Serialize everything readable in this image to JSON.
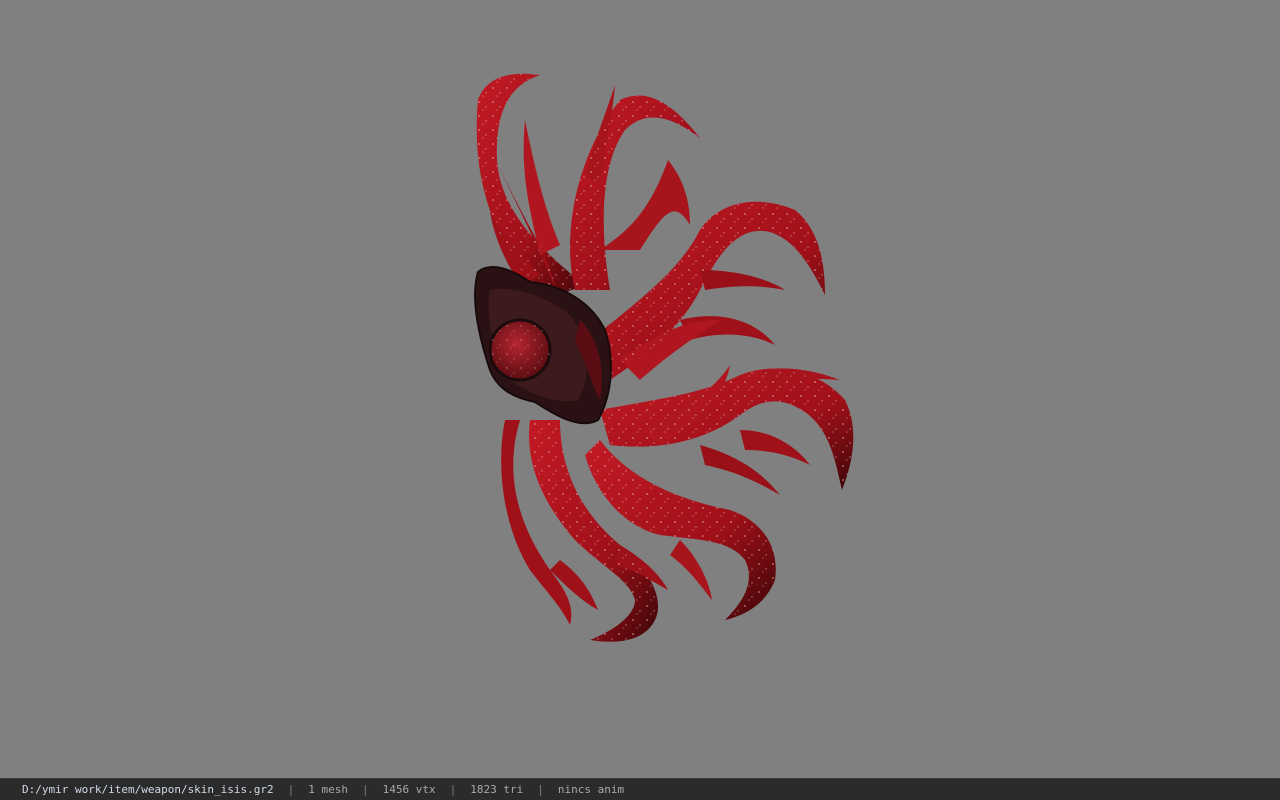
{
  "viewer": {
    "background_color": "#808080",
    "model_icon": "red-tentacle-shield-model",
    "model_colors": {
      "flesh": "#a8141c",
      "flesh_dark": "#4a0a0e",
      "core": "#2a1214",
      "eye": "#8f1a22"
    }
  },
  "statusbar": {
    "file_path": "D:/ymir work/item/weapon/skin_isis.gr2",
    "mesh_count": "1 mesh",
    "vertex_count": "1456 vtx",
    "triangle_count": "1823 tri",
    "animation_status": "nincs anim",
    "separator": "|"
  }
}
